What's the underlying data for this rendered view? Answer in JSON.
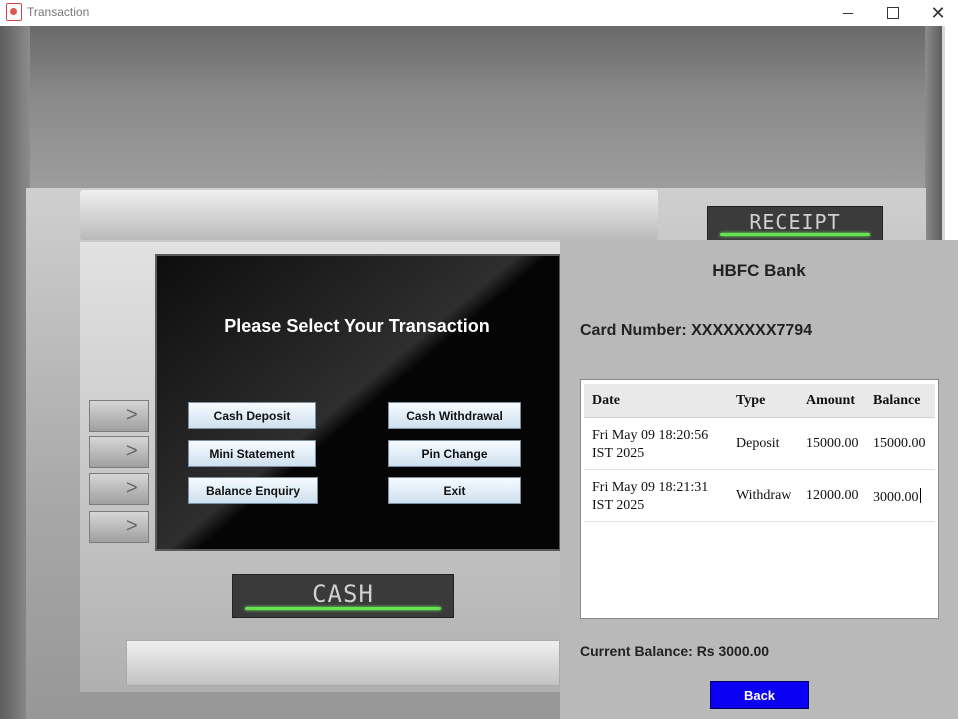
{
  "window": {
    "title": "Transaction",
    "icon": "java-cup-icon"
  },
  "atm": {
    "receipt_label": "RECEIPT",
    "cash_label": "CASH",
    "screen_title": "Please Select Your Transaction",
    "buttons": {
      "cash_deposit": "Cash Deposit",
      "cash_withdrawal": "Cash Withdrawal",
      "mini_statement": "Mini Statement",
      "pin_change": "Pin Change",
      "balance_enquiry": "Balance Enquiry",
      "exit": "Exit"
    },
    "side_key_glyph": ">"
  },
  "receipt": {
    "bank_name": "HBFC Bank",
    "card_number_label": "Card Number: XXXXXXXX7794",
    "table": {
      "headers": [
        "Date",
        "Type",
        "Amount",
        "Balance"
      ],
      "rows": [
        {
          "date_line1": "Fri May 09 18:20:56",
          "date_line2": "IST 2025",
          "type": "Deposit",
          "amount": "15000.00",
          "balance": "15000.00"
        },
        {
          "date_line1": "Fri May 09 18:21:31",
          "date_line2": "IST 2025",
          "type": "Withdraw",
          "amount": "12000.00",
          "balance": "3000.00"
        }
      ]
    },
    "current_balance": "Current Balance: Rs 3000.00",
    "back_label": "Back"
  },
  "colors": {
    "led_green": "#65e34a",
    "back_button_blue": "#0b00f5",
    "panel_gray": "#b9b9b9"
  }
}
